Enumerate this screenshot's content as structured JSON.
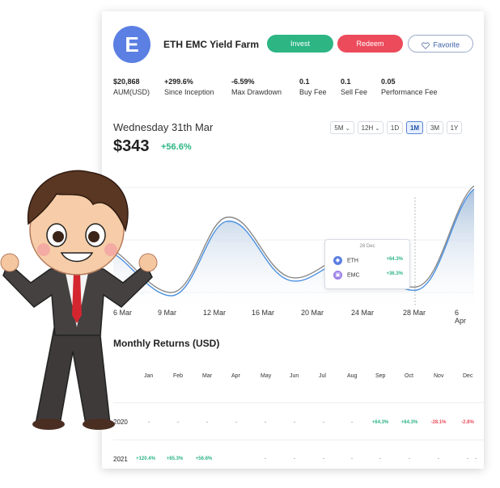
{
  "fund": {
    "avatar_letter": "E",
    "title": "ETH EMC Yield Farm"
  },
  "actions": {
    "invest": "Invest",
    "redeem": "Redeem",
    "favorite": "Favorite"
  },
  "stats": [
    {
      "value": "$20,868",
      "label": "AUM(USD)"
    },
    {
      "value": "+299.6%",
      "label": "Since Inception"
    },
    {
      "value": "-6.59%",
      "label": "Max Drawdown"
    },
    {
      "value": "0.1",
      "label": "Buy Fee"
    },
    {
      "value": "0.1",
      "label": "Sell Fee"
    },
    {
      "value": "0.05",
      "label": "Performance Fee"
    }
  ],
  "price_header": {
    "date": "Wednesday 31th Mar",
    "price": "$343",
    "change": "+56.6%"
  },
  "interval_selects": [
    "5M",
    "12H"
  ],
  "ranges": [
    "1D",
    "1M",
    "3M",
    "1Y"
  ],
  "active_range": "1M",
  "chart": {
    "x_labels": [
      "6 Mar",
      "9 Mar",
      "12 Mar",
      "16 Mar",
      "20 Mar",
      "24 Mar",
      "28 Mar",
      "6 Apr"
    ],
    "tooltip": {
      "date": "28 Dec",
      "rows": [
        {
          "coin": "ETH",
          "change": "+64.3%"
        },
        {
          "coin": "EMC",
          "change": "+36.3%"
        }
      ]
    },
    "colors": {
      "line": "#4a90e2",
      "line2": "#888888",
      "fill": "#cfdeef"
    }
  },
  "monthly": {
    "title": "Monthly Returns (USD)",
    "months": [
      "Jan",
      "Feb",
      "Mar",
      "Apr",
      "May",
      "Jun",
      "Jul",
      "Aug",
      "Sep",
      "Oct",
      "Nov",
      "Dec"
    ],
    "rows": [
      {
        "year": "2020",
        "cells": [
          "-",
          "-",
          "-",
          "-",
          "-",
          "-",
          "-",
          "-",
          "+64.3%",
          "+64.3%",
          "-28.1%",
          "-2.8%"
        ]
      },
      {
        "year": "2021",
        "cells": [
          "+120.4%",
          "+85.3%",
          "+56.6%",
          "-",
          "-",
          "-",
          "-",
          "-",
          "-",
          "-",
          "-",
          "-"
        ]
      }
    ]
  },
  "colors": {
    "green": "#2db584",
    "red": "#ec4b5c",
    "blue": "#5b7fe2"
  }
}
